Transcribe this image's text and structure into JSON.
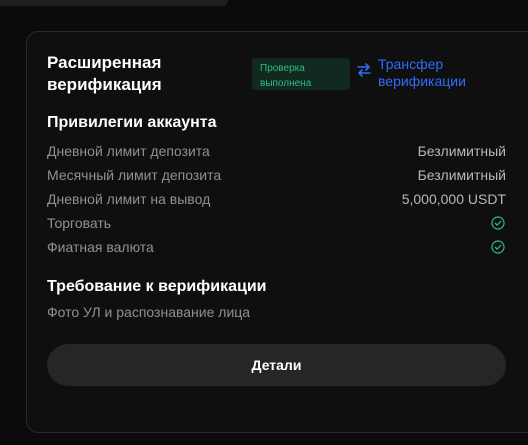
{
  "card": {
    "title": "Расширенная верификация",
    "badge": "Проверка выполнена",
    "transfer_label": "Трансфер верификации",
    "transfer_icon": "swap-arrows-icon"
  },
  "privileges": {
    "title": "Привилегии аккаунта",
    "rows": [
      {
        "label": "Дневной лимит депозита",
        "value": "Безлимитный"
      },
      {
        "label": "Месячный лимит депозита",
        "value": "Безлимитный"
      },
      {
        "label": "Дневной лимит на вывод",
        "value": "5,000,000 USDT"
      },
      {
        "label": "Торговать",
        "icon": "check-circle-icon"
      },
      {
        "label": "Фиатная валюта",
        "icon": "check-circle-icon"
      }
    ]
  },
  "requirement": {
    "title": "Требование к верификации",
    "text": "Фото УЛ и распознавание лица"
  },
  "details_button": "Детали",
  "colors": {
    "accent_green": "#2ebd85",
    "accent_blue": "#2f6df6",
    "card_bg": "#0f0f10",
    "button_bg": "#262629"
  }
}
